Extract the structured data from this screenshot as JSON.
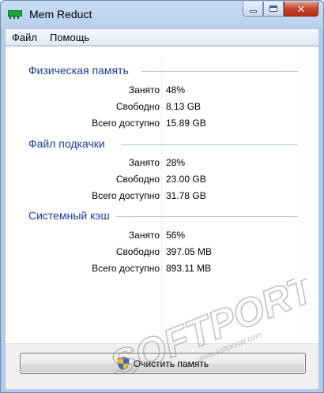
{
  "window": {
    "title": "Mem Reduct",
    "icons": {
      "app": "ram-chip-icon",
      "minimize": "minimize-icon",
      "maximize": "maximize-icon",
      "close": "close-icon"
    }
  },
  "menu": {
    "items": [
      {
        "label": "Файл"
      },
      {
        "label": "Помощь"
      }
    ]
  },
  "groups": [
    {
      "title": "Физическая память",
      "rows": [
        {
          "label": "Занято",
          "value": "48%"
        },
        {
          "label": "Свободно",
          "value": "8.13 GB"
        },
        {
          "label": "Всего доступно",
          "value": "15.89 GB"
        }
      ]
    },
    {
      "title": "Файл подкачки",
      "rows": [
        {
          "label": "Занято",
          "value": "28%"
        },
        {
          "label": "Свободно",
          "value": "23.00 GB"
        },
        {
          "label": "Всего доступно",
          "value": "31.78 GB"
        }
      ]
    },
    {
      "title": "Системный кэш",
      "rows": [
        {
          "label": "Занято",
          "value": "56%"
        },
        {
          "label": "Свободно",
          "value": "397.05 MB"
        },
        {
          "label": "Всего доступно",
          "value": "893.11 MB"
        }
      ]
    }
  ],
  "clean_button": {
    "label": "Очистить память",
    "icon": "uac-shield-icon"
  },
  "watermark": {
    "brand": "SOFTPORTAL",
    "url": "www.softportal.com",
    "trademark": "TM"
  },
  "colors": {
    "group_title": "#1e3a9a",
    "close_button": "#c7442c"
  }
}
